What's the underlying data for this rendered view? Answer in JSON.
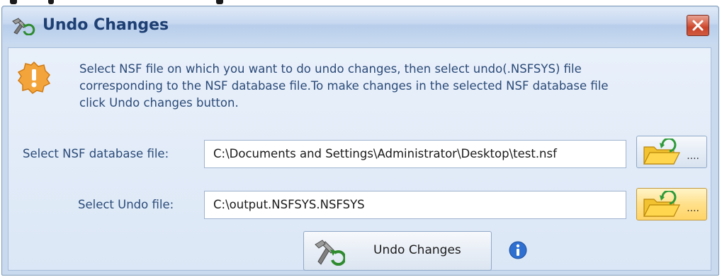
{
  "window": {
    "title": "Undo Changes",
    "accent": "#1e3f73",
    "close_color": "#c9432a"
  },
  "info": {
    "line1": "Select NSF file on which you want to do undo changes, then select undo(.NSFSYS) file",
    "line2": "corresponding to the NSF database file.To make changes in the selected NSF database file",
    "line3": "click Undo changes button."
  },
  "nsf_field": {
    "label": "Select NSF database file:",
    "value": "C:\\Documents and Settings\\Administrator\\Desktop\\test.nsf"
  },
  "undo_field": {
    "label": "Select Undo file:",
    "value": "C:\\output.NSFSYS.NSFSYS"
  },
  "browse_nsf": {
    "ellipsis": "....",
    "icon": "folder-open-icon"
  },
  "browse_undo": {
    "ellipsis": "....",
    "icon": "folder-open-icon"
  },
  "action_button": {
    "label": "Undo Changes",
    "icon": "undo-tools-icon"
  },
  "icons": {
    "warning": "warning-icon",
    "help": "info-icon"
  }
}
